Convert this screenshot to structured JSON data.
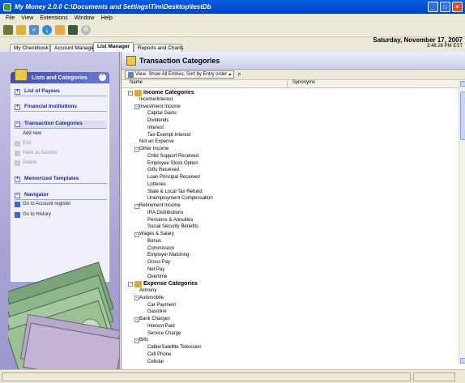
{
  "window": {
    "title": "My Money 2.0.0 C:\\Documents and Settings\\Tim\\Desktop\\testDb"
  },
  "menu": [
    "File",
    "View",
    "Extensions",
    "Window",
    "Help"
  ],
  "tabs": [
    "My Checkbook",
    "Account Manager",
    "List Manager",
    "Reports and Charts"
  ],
  "active_tab": "List Manager",
  "date": "Saturday, November 17, 2007",
  "time": "3:48:26 PM EST",
  "left": {
    "header": "Lists and Categories",
    "sections": {
      "payees": "List of Payees",
      "institutions": "Financial Institutions",
      "categories": "Transaction Categories",
      "add_new": "Add new",
      "edit": "Edit",
      "favorite": "Mark as favorite",
      "delete": "Delete",
      "templates": "Memorized Templates",
      "navigator": "Navigator",
      "goto_register": "Go to Account register",
      "goto_history": "Go to History"
    }
  },
  "content": {
    "title": "Transaction Categories",
    "view": "View: Show All Entries, Sort by Entry order",
    "columns": {
      "name": "Name",
      "synonyms": "Synonyms"
    }
  },
  "tree": [
    {
      "label": "Income Categories",
      "level": 0,
      "kind": "group",
      "exp": "-"
    },
    {
      "label": "Income/Interest",
      "level": 1
    },
    {
      "label": "Investment Income",
      "level": 1,
      "exp": "-"
    },
    {
      "label": "Capital Gains",
      "level": 2
    },
    {
      "label": "Dividends",
      "level": 2
    },
    {
      "label": "Interest",
      "level": 2
    },
    {
      "label": "Tax-Exempt Interest",
      "level": 2
    },
    {
      "label": "Not an Expense",
      "level": 1
    },
    {
      "label": "Other Income",
      "level": 1,
      "exp": "-"
    },
    {
      "label": "Child Support Received",
      "level": 2
    },
    {
      "label": "Employee Stock Option",
      "level": 2
    },
    {
      "label": "Gifts Received",
      "level": 2
    },
    {
      "label": "Loan Principal Received",
      "level": 2
    },
    {
      "label": "Lotteries",
      "level": 2
    },
    {
      "label": "State & Local Tax Refund",
      "level": 2
    },
    {
      "label": "Unemployment Compensation",
      "level": 2
    },
    {
      "label": "Retirement Income",
      "level": 1,
      "exp": "-"
    },
    {
      "label": "IRA Distributions",
      "level": 2
    },
    {
      "label": "Pensions & Annuities",
      "level": 2
    },
    {
      "label": "Social Security Benefits",
      "level": 2
    },
    {
      "label": "Wages & Salary",
      "level": 1,
      "exp": "-"
    },
    {
      "label": "Bonus",
      "level": 2
    },
    {
      "label": "Commission",
      "level": 2
    },
    {
      "label": "Employer Matching",
      "level": 2
    },
    {
      "label": "Gross Pay",
      "level": 2
    },
    {
      "label": "Net Pay",
      "level": 2
    },
    {
      "label": "Overtime",
      "level": 2
    },
    {
      "label": "Expense Categories",
      "level": 0,
      "kind": "group",
      "exp": "-"
    },
    {
      "label": "Alimony",
      "level": 1
    },
    {
      "label": "Automobile",
      "level": 1,
      "exp": "-"
    },
    {
      "label": "Car Payment",
      "level": 2
    },
    {
      "label": "Gasoline",
      "level": 2
    },
    {
      "label": "Bank Charges",
      "level": 1,
      "exp": "-"
    },
    {
      "label": "Interest Paid",
      "level": 2
    },
    {
      "label": "Service Charge",
      "level": 2
    },
    {
      "label": "Bills",
      "level": 1,
      "exp": "-"
    },
    {
      "label": "Cable/Satellite Television",
      "level": 2
    },
    {
      "label": "Cell Phone",
      "level": 2
    },
    {
      "label": "Cellular",
      "level": 2
    }
  ]
}
